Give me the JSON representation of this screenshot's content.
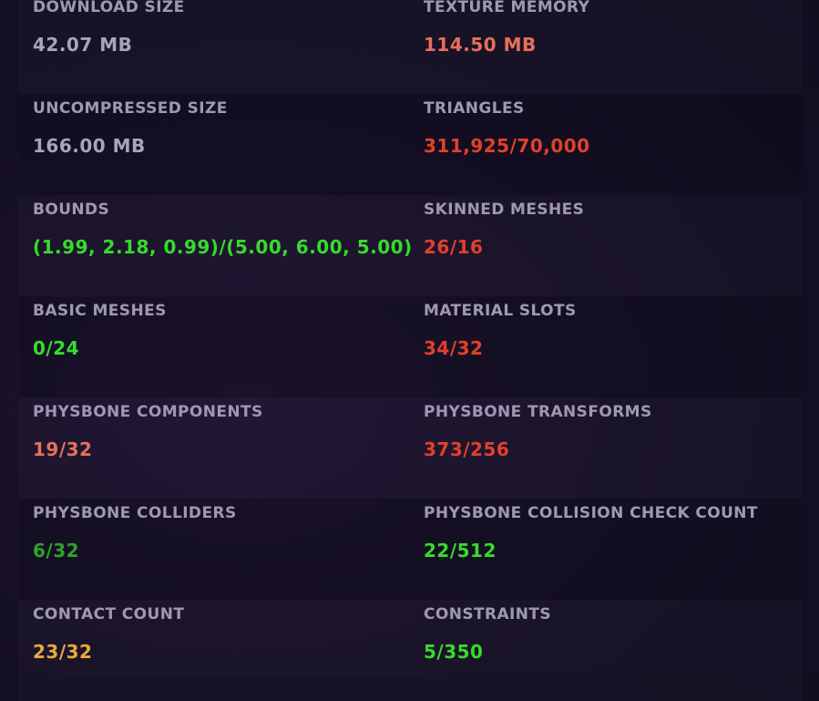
{
  "colors": {
    "neutral": "#a9a4b8",
    "orange_red": "#e86f5b",
    "red": "#e2402b",
    "green": "#35dc2a",
    "dark_green": "#2ea32a",
    "amber": "#e9a93a"
  },
  "rows": [
    {
      "left": {
        "label": "DOWNLOAD SIZE",
        "value": "42.07 MB",
        "color": "#a9a4b8"
      },
      "right": {
        "label": "TEXTURE MEMORY",
        "value": "114.50 MB",
        "color": "#e86f5b"
      }
    },
    {
      "left": {
        "label": "UNCOMPRESSED SIZE",
        "value": "166.00 MB",
        "color": "#a9a4b8"
      },
      "right": {
        "label": "TRIANGLES",
        "value": "311,925/70,000",
        "color": "#e2402b"
      }
    },
    {
      "left": {
        "label": "BOUNDS",
        "value": "(1.99, 2.18, 0.99)/(5.00, 6.00, 5.00)",
        "color": "#35dc2a"
      },
      "right": {
        "label": "SKINNED MESHES",
        "value": "26/16",
        "color": "#e2402b"
      }
    },
    {
      "left": {
        "label": "BASIC MESHES",
        "value": "0/24",
        "color": "#35dc2a"
      },
      "right": {
        "label": "MATERIAL SLOTS",
        "value": "34/32",
        "color": "#e2402b"
      }
    },
    {
      "left": {
        "label": "PHYSBONE COMPONENTS",
        "value": "19/32",
        "color": "#e86f5b"
      },
      "right": {
        "label": "PHYSBONE TRANSFORMS",
        "value": "373/256",
        "color": "#e2402b"
      }
    },
    {
      "left": {
        "label": "PHYSBONE COLLIDERS",
        "value": "6/32",
        "color": "#2ea32a"
      },
      "right": {
        "label": "PHYSBONE COLLISION CHECK COUNT",
        "value": "22/512",
        "color": "#35dc2a"
      }
    },
    {
      "left": {
        "label": "CONTACT COUNT",
        "value": "23/32",
        "color": "#e9a93a"
      },
      "right": {
        "label": "CONSTRAINTS",
        "value": "5/350",
        "color": "#35dc2a"
      }
    }
  ]
}
